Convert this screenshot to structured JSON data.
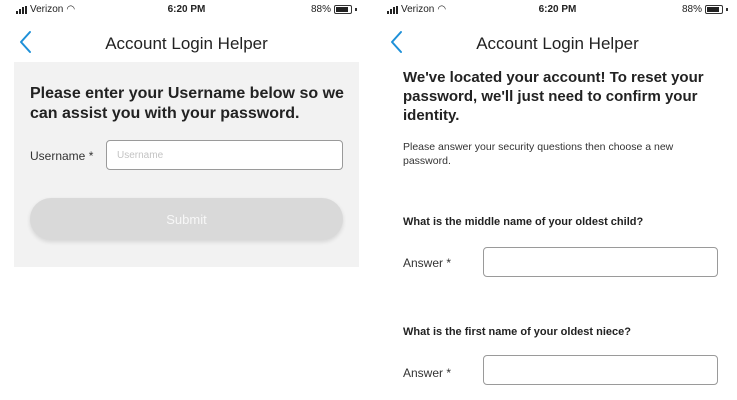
{
  "status_bar": {
    "carrier": "Verizon",
    "time": "6:20 PM",
    "battery": "88%",
    "battery_level": 0.88
  },
  "left_screen": {
    "title": "Account Login Helper",
    "heading": "Please enter your Username below so we can assist you with your password.",
    "username_label": "Username *",
    "username_placeholder": "Username",
    "submit_label": "Submit"
  },
  "right_screen": {
    "title": "Account Login Helper",
    "heading": "We've located your account! To reset your password, we'll just need to confirm your identity.",
    "intro": "Please answer your security questions then choose a new password.",
    "questions": [
      {
        "text": "What is the middle name of your oldest child?",
        "answer_label": "Answer *",
        "answer_value": ""
      },
      {
        "text": "What is the first name of your oldest niece?",
        "answer_label": "Answer *",
        "answer_value": ""
      }
    ]
  },
  "colors": {
    "accent": "#1e90d8",
    "panel_bg": "#f2f2f2",
    "button_disabled": "#d9d9d9"
  }
}
